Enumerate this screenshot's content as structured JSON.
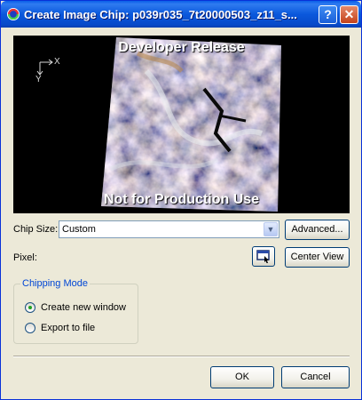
{
  "window": {
    "title": "Create Image Chip: p039r035_7t20000503_z11_s...",
    "help_glyph": "?",
    "close_glyph": "✕",
    "icons": {
      "app": "envi-app-icon",
      "help": "help-icon",
      "close": "close-icon"
    }
  },
  "preview": {
    "watermark_top": "Developer Release",
    "watermark_bottom": "Not for Production Use",
    "axis_x": "X",
    "axis_y": "Y"
  },
  "chip_size": {
    "label": "Chip Size:",
    "value": "Custom",
    "dropdown_glyph": "▼",
    "advanced_label": "Advanced..."
  },
  "pixel": {
    "label": "Pixel:",
    "select_icon": "pixel-select-icon",
    "center_view_label": "Center View"
  },
  "chipping_mode": {
    "title": "Chipping Mode",
    "options": [
      {
        "label": "Create new window",
        "selected": true
      },
      {
        "label": "Export to file",
        "selected": false
      }
    ]
  },
  "footer": {
    "ok_label": "OK",
    "cancel_label": "Cancel"
  },
  "colors": {
    "title_bar": "#0a58dc",
    "dialog_bg": "#ece9d8",
    "group_title": "#0046d5",
    "radio_selected": "#21a121"
  }
}
